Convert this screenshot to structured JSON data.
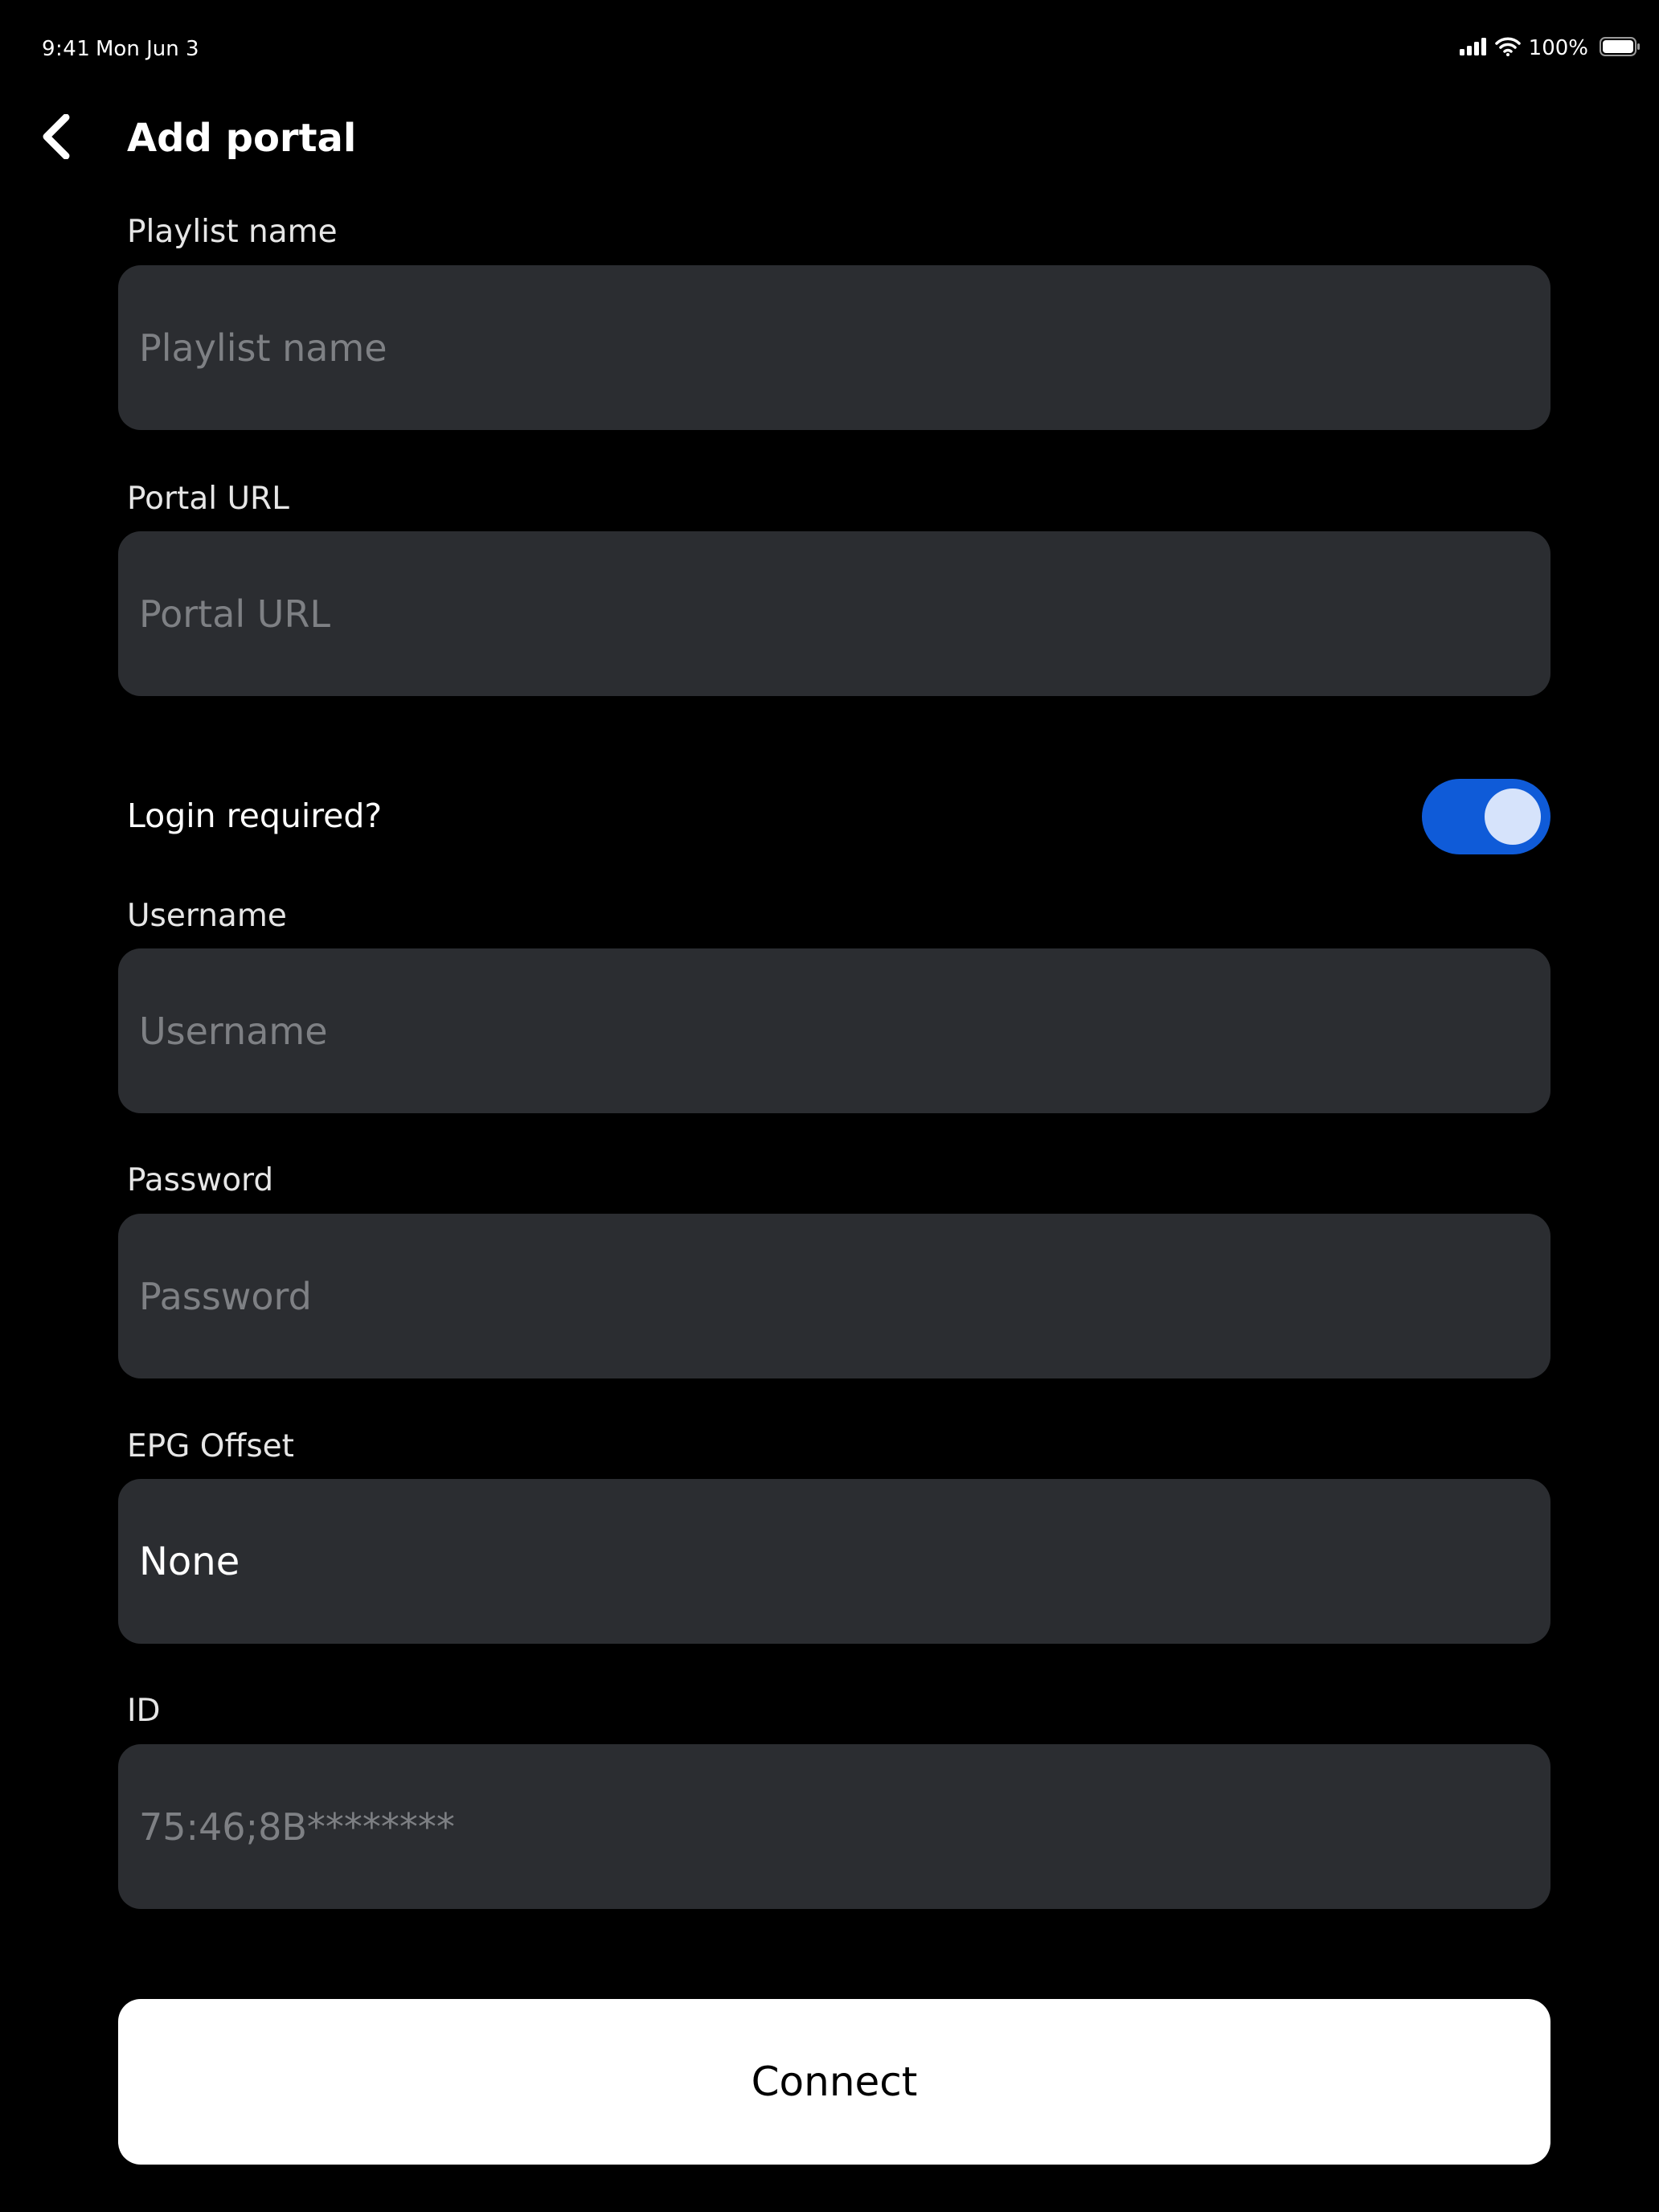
{
  "status_bar": {
    "time": "9:41",
    "date": "Mon Jun 3",
    "battery": "100%",
    "icons": [
      "cellular-signal-icon",
      "wifi-icon",
      "battery-icon"
    ]
  },
  "header": {
    "title": "Add portal",
    "back_icon": "chevron-left-icon"
  },
  "form": {
    "playlist_name": {
      "label": "Playlist name",
      "placeholder": "Playlist name",
      "value": ""
    },
    "portal_url": {
      "label": "Portal URL",
      "placeholder": "Portal URL",
      "value": ""
    },
    "login_required": {
      "label": "Login required?",
      "enabled": true
    },
    "username": {
      "label": "Username",
      "placeholder": "Username",
      "value": ""
    },
    "password": {
      "label": "Password",
      "placeholder": "Password",
      "value": ""
    },
    "epg_offset": {
      "label": "EPG Offset",
      "value": "None"
    },
    "id": {
      "label": "ID",
      "value": "75:46;8B********"
    }
  },
  "actions": {
    "connect_label": "Connect"
  },
  "colors": {
    "background": "#000000",
    "field_background": "#2b2d31",
    "placeholder": "#7e8084",
    "toggle_on": "#0f5bd8",
    "toggle_knob": "#d6e3fb",
    "button_background": "#ffffff"
  }
}
